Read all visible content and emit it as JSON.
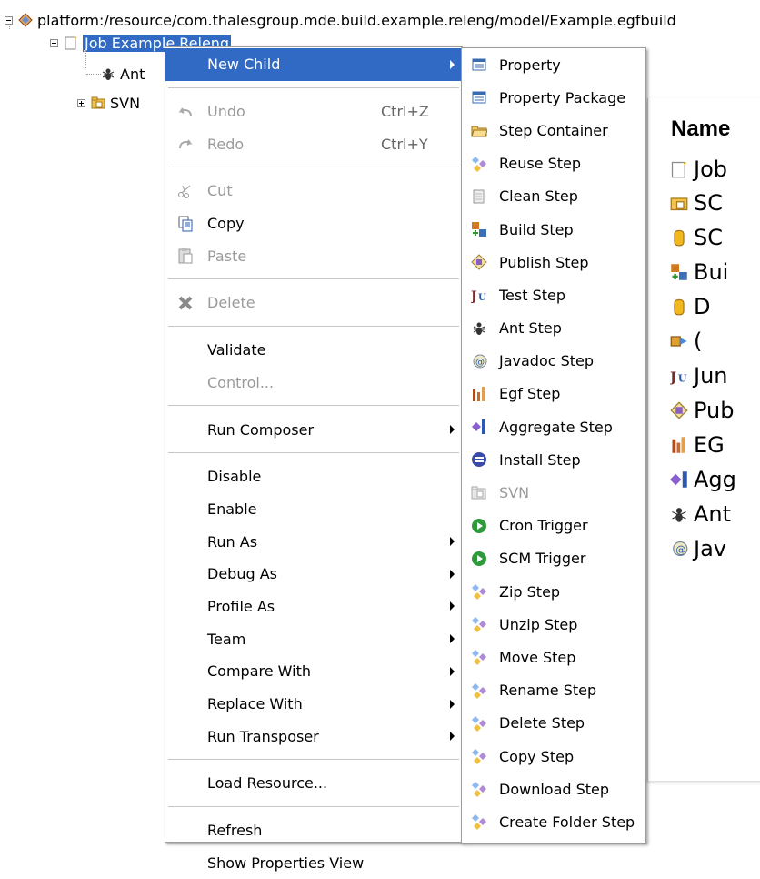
{
  "tree": {
    "root_label": "platform:/resource/com.thalesgroup.mde.build.example.releng/model/Example.egfbuild",
    "job_label": "Job Example Releng",
    "children": [
      {
        "label": "Ant",
        "icon": "ant-icon"
      },
      {
        "label": "SVN",
        "icon": "svn-folder-icon"
      }
    ]
  },
  "context_menu": {
    "items": [
      {
        "label": "New Child",
        "submenu": true,
        "highlighted": true
      },
      {
        "type": "separator"
      },
      {
        "label": "Undo",
        "accelerator": "Ctrl+Z",
        "disabled": true,
        "icon": "undo-icon"
      },
      {
        "label": "Redo",
        "accelerator": "Ctrl+Y",
        "disabled": true,
        "icon": "redo-icon"
      },
      {
        "type": "separator"
      },
      {
        "label": "Cut",
        "disabled": true,
        "icon": "cut-icon"
      },
      {
        "label": "Copy",
        "icon": "copy-icon"
      },
      {
        "label": "Paste",
        "disabled": true,
        "icon": "paste-icon"
      },
      {
        "type": "separator"
      },
      {
        "label": "Delete",
        "disabled": true,
        "icon": "delete-icon"
      },
      {
        "type": "separator"
      },
      {
        "label": "Validate"
      },
      {
        "label": "Control...",
        "disabled": true
      },
      {
        "type": "separator"
      },
      {
        "label": "Run Composer",
        "submenu": true
      },
      {
        "type": "separator"
      },
      {
        "label": "Disable"
      },
      {
        "label": "Enable"
      },
      {
        "label": "Run As",
        "submenu": true
      },
      {
        "label": "Debug As",
        "submenu": true
      },
      {
        "label": "Profile As",
        "submenu": true
      },
      {
        "label": "Team",
        "submenu": true
      },
      {
        "label": "Compare With",
        "submenu": true
      },
      {
        "label": "Replace With",
        "submenu": true
      },
      {
        "label": "Run Transposer",
        "submenu": true
      },
      {
        "type": "separator"
      },
      {
        "label": "Load Resource..."
      },
      {
        "type": "separator"
      },
      {
        "label": "Refresh"
      },
      {
        "label": "Show Properties View"
      }
    ]
  },
  "new_child_submenu": {
    "items": [
      {
        "label": "Property",
        "icon": "property-icon"
      },
      {
        "label": "Property Package",
        "icon": "property-package-icon"
      },
      {
        "label": "Step Container",
        "icon": "step-container-icon"
      },
      {
        "label": "Reuse Step",
        "icon": "reuse-step-icon"
      },
      {
        "label": "Clean Step",
        "icon": "clean-step-icon"
      },
      {
        "label": "Build Step",
        "icon": "build-step-icon"
      },
      {
        "label": "Publish Step",
        "icon": "publish-step-icon"
      },
      {
        "label": "Test Step",
        "icon": "junit-icon"
      },
      {
        "label": "Ant Step",
        "icon": "ant-icon"
      },
      {
        "label": "Javadoc Step",
        "icon": "javadoc-icon"
      },
      {
        "label": "Egf Step",
        "icon": "egf-icon"
      },
      {
        "label": "Aggregate Step",
        "icon": "aggregate-icon"
      },
      {
        "label": "Install Step",
        "icon": "install-icon"
      },
      {
        "label": "SVN",
        "icon": "svn-folder-icon",
        "disabled": true
      },
      {
        "label": "Cron Trigger",
        "icon": "trigger-icon"
      },
      {
        "label": "SCM Trigger",
        "icon": "trigger-icon"
      },
      {
        "label": "Zip Step",
        "icon": "step-icon"
      },
      {
        "label": "Unzip Step",
        "icon": "step-icon"
      },
      {
        "label": "Move Step",
        "icon": "step-icon"
      },
      {
        "label": "Rename Step",
        "icon": "step-icon"
      },
      {
        "label": "Delete Step",
        "icon": "step-icon"
      },
      {
        "label": "Copy Step",
        "icon": "step-icon"
      },
      {
        "label": "Download Step",
        "icon": "step-icon"
      },
      {
        "label": "Create Folder Step",
        "icon": "step-icon"
      }
    ]
  },
  "properties_panel": {
    "header": "Name",
    "rows": [
      {
        "text": "Job",
        "icon": "job-icon"
      },
      {
        "text": "SC",
        "icon": "svn-folder-icon"
      },
      {
        "text": "SC",
        "icon": "cylinder-icon"
      },
      {
        "text": "Bui",
        "icon": "build-step-icon"
      },
      {
        "text": "D",
        "icon": "cylinder-icon"
      },
      {
        "text": "(",
        "icon": "connector-icon"
      },
      {
        "text": "Jun",
        "icon": "junit-icon"
      },
      {
        "text": "Pub",
        "icon": "publish-step-icon"
      },
      {
        "text": "EG",
        "icon": "egf-icon"
      },
      {
        "text": "Agg",
        "icon": "aggregate-icon"
      },
      {
        "text": "Ant",
        "icon": "ant-icon"
      },
      {
        "text": "Jav",
        "icon": "javadoc-icon"
      }
    ]
  },
  "colors": {
    "selection": "#316ac5",
    "menu_border": "#9d9d9d",
    "disabled_text": "#9a9a9a"
  }
}
